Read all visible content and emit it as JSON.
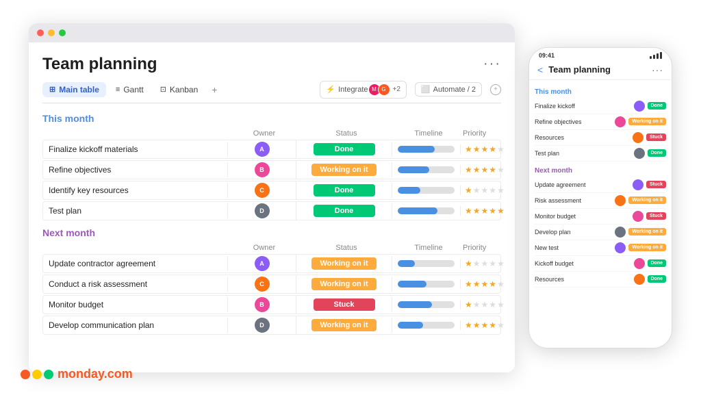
{
  "app": {
    "title": "Team planning",
    "more_label": "···"
  },
  "window": {
    "dots": [
      "red",
      "yellow",
      "green"
    ]
  },
  "tabs": [
    {
      "label": "Main table",
      "icon": "⊞",
      "active": true
    },
    {
      "label": "Gantt",
      "icon": "≡",
      "active": false
    },
    {
      "label": "Kanban",
      "icon": "⊡",
      "active": false
    }
  ],
  "toolbar": {
    "add": "+",
    "integrate": "Integrate",
    "automate": "Automate / 2",
    "badge": "+2"
  },
  "sections": [
    {
      "id": "this-month",
      "title": "This month",
      "color": "blue",
      "columns": [
        "",
        "Owner",
        "Status",
        "Timeline",
        "Priority"
      ],
      "rows": [
        {
          "task": "Finalize kickoff materials",
          "owner_color": "#8B5CF6",
          "owner_initials": "A",
          "status": "Done",
          "status_class": "status-done",
          "timeline_pct": 65,
          "stars": 4
        },
        {
          "task": "Refine objectives",
          "owner_color": "#EC4899",
          "owner_initials": "B",
          "status": "Working on it",
          "status_class": "status-working",
          "timeline_pct": 55,
          "stars": 4
        },
        {
          "task": "Identify key resources",
          "owner_color": "#F97316",
          "owner_initials": "C",
          "status": "Done",
          "status_class": "status-done",
          "timeline_pct": 40,
          "stars": 1
        },
        {
          "task": "Test plan",
          "owner_color": "#6B7280",
          "owner_initials": "D",
          "status": "Done",
          "status_class": "status-done",
          "timeline_pct": 70,
          "stars": 5
        }
      ]
    },
    {
      "id": "next-month",
      "title": "Next month",
      "color": "purple",
      "columns": [
        "",
        "Owner",
        "Status",
        "Timeline",
        "Priority"
      ],
      "rows": [
        {
          "task": "Update contractor agreement",
          "owner_color": "#8B5CF6",
          "owner_initials": "A",
          "status": "Working on it",
          "status_class": "status-working",
          "timeline_pct": 30,
          "stars": 1
        },
        {
          "task": "Conduct a risk assessment",
          "owner_color": "#F97316",
          "owner_initials": "C",
          "status": "Working on it",
          "status_class": "status-working",
          "timeline_pct": 50,
          "stars": 4
        },
        {
          "task": "Monitor budget",
          "owner_color": "#EC4899",
          "owner_initials": "B",
          "status": "Stuck",
          "status_class": "status-stuck",
          "timeline_pct": 60,
          "stars": 1
        },
        {
          "task": "Develop communication plan",
          "owner_color": "#6B7280",
          "owner_initials": "D",
          "status": "Working on it",
          "status_class": "status-working",
          "timeline_pct": 45,
          "stars": 4
        }
      ]
    }
  ],
  "mobile": {
    "time": "09:41",
    "title": "Team planning",
    "back": "<",
    "more": "···",
    "sections": [
      {
        "title": "This month",
        "color": "blue",
        "rows": [
          {
            "task": "Finalize kickoff",
            "status": "Done",
            "status_class": "status-done",
            "owner_color": "#8B5CF6"
          },
          {
            "task": "Refine objectives",
            "status": "Working on it",
            "status_class": "status-working",
            "owner_color": "#EC4899"
          },
          {
            "task": "Resources",
            "status": "Stuck",
            "status_class": "status-stuck",
            "owner_color": "#F97316"
          },
          {
            "task": "Test plan",
            "status": "Done",
            "status_class": "status-done",
            "owner_color": "#6B7280"
          }
        ]
      },
      {
        "title": "Next month",
        "color": "purple",
        "rows": [
          {
            "task": "Update agreement",
            "status": "Stuck",
            "status_class": "status-stuck",
            "owner_color": "#8B5CF6"
          },
          {
            "task": "Risk assessment",
            "status": "Working on it",
            "status_class": "status-working",
            "owner_color": "#F97316"
          },
          {
            "task": "Monitor budget",
            "status": "Stuck",
            "status_class": "status-stuck",
            "owner_color": "#EC4899"
          },
          {
            "task": "Develop plan",
            "status": "Working on it",
            "status_class": "status-working",
            "owner_color": "#6B7280"
          },
          {
            "task": "New test",
            "status": "Working on it",
            "status_class": "status-working",
            "owner_color": "#8B5CF6"
          },
          {
            "task": "Kickoff budget",
            "status": "Done",
            "status_class": "status-done",
            "owner_color": "#EC4899"
          },
          {
            "task": "Resources",
            "status": "Done",
            "status_class": "status-done",
            "owner_color": "#F97316"
          }
        ]
      }
    ]
  },
  "logo": {
    "text": "monday",
    "suffix": ".com",
    "dot_colors": [
      "#f65a23",
      "#ffcc00",
      "#00ca72"
    ]
  }
}
